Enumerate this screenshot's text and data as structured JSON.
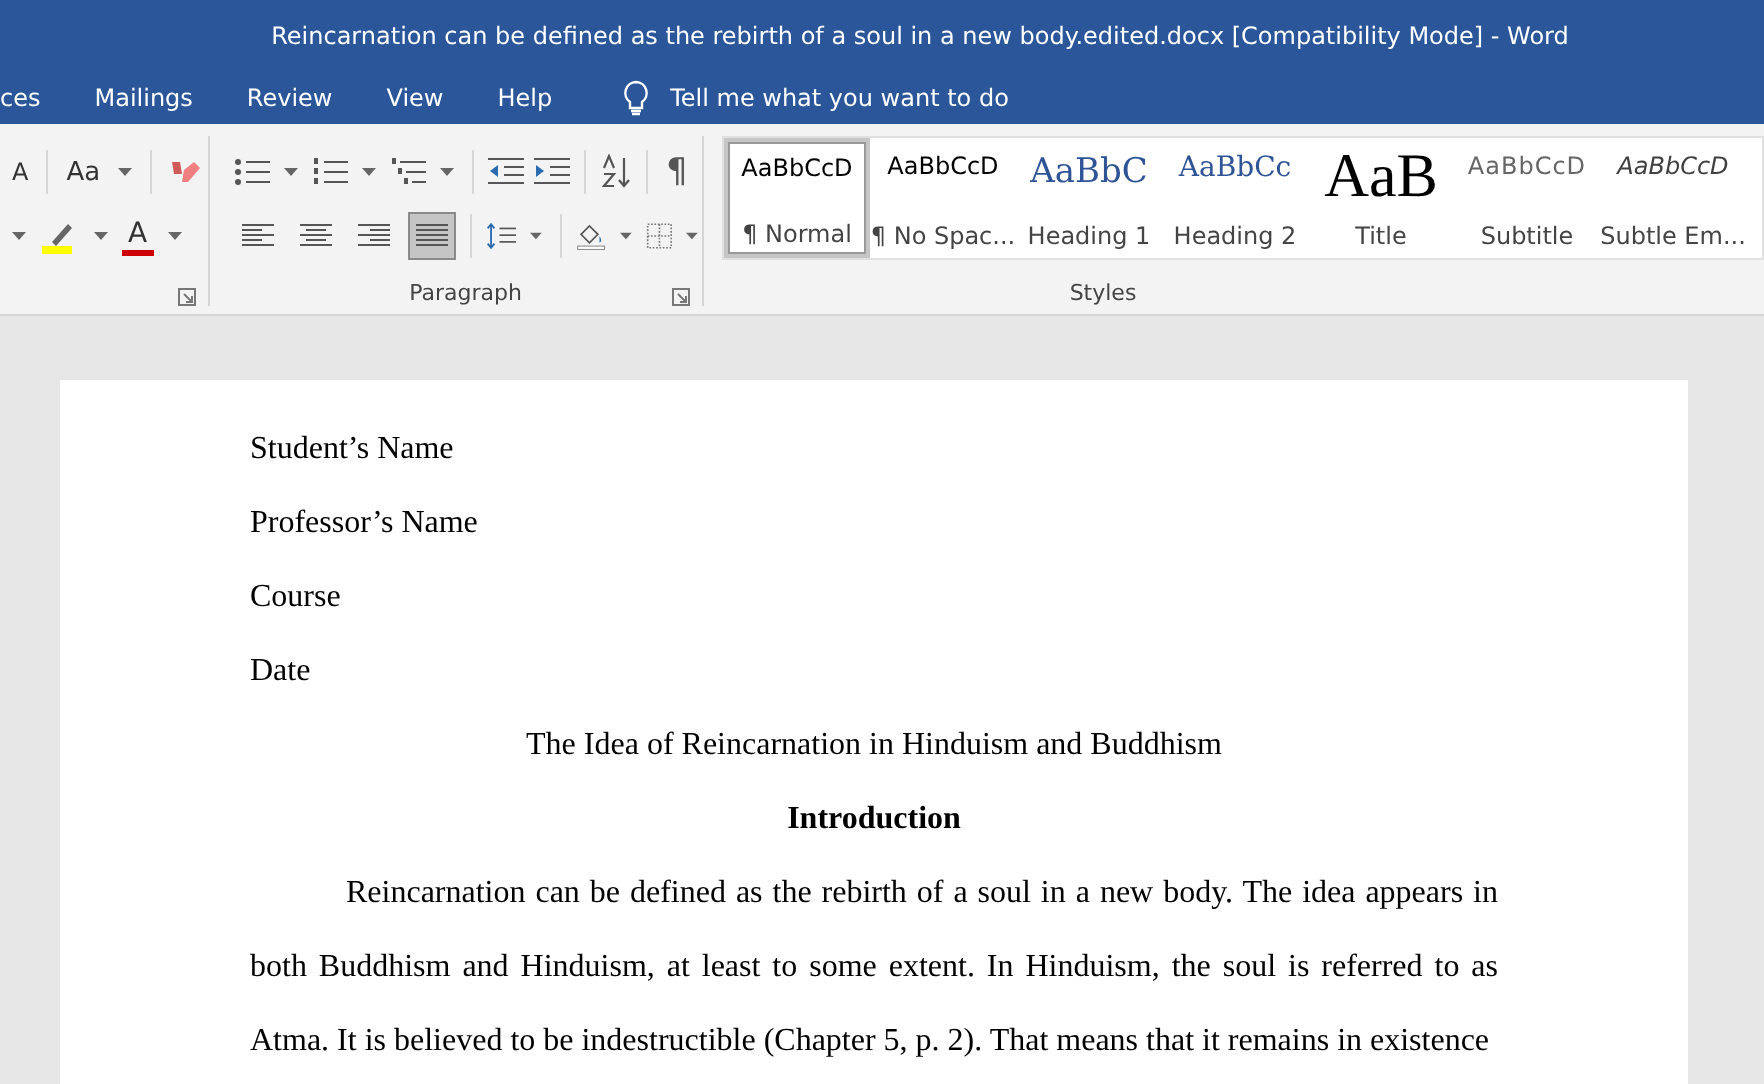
{
  "window": {
    "title": "Reincarnation can be defined as the rebirth of a soul in a new body.edited.docx [Compatibility Mode]  -  Word"
  },
  "tabs": [
    {
      "label": "ces",
      "selected": false
    },
    {
      "label": "Mailings",
      "selected": false
    },
    {
      "label": "Review",
      "selected": false
    },
    {
      "label": "View",
      "selected": false
    },
    {
      "label": "Help",
      "selected": false
    }
  ],
  "tell_me": {
    "placeholder": "Tell me what you want to do"
  },
  "font_group": {
    "grow_font": "A",
    "change_case": "Aa",
    "font_color": "A"
  },
  "paragraph_group": {
    "label": "Paragraph",
    "pilcrow": "¶",
    "alignments": [
      {
        "kind": "left",
        "selected": false
      },
      {
        "kind": "center",
        "selected": false
      },
      {
        "kind": "right",
        "selected": false
      },
      {
        "kind": "justify",
        "selected": true
      }
    ]
  },
  "styles": {
    "label": "Styles",
    "items": [
      {
        "kind": "normal",
        "sample": "AaBbCcD",
        "name": "¶ Normal",
        "selected": true
      },
      {
        "kind": "nospacing",
        "sample": "AaBbCcD",
        "name": "¶ No Spac...",
        "selected": false
      },
      {
        "kind": "heading1",
        "sample": "AaBbC",
        "name": "Heading 1",
        "selected": false
      },
      {
        "kind": "heading2",
        "sample": "AaBbCc",
        "name": "Heading 2",
        "selected": false
      },
      {
        "kind": "title",
        "sample": "AaB",
        "name": "Title",
        "selected": false
      },
      {
        "kind": "subtitle",
        "sample": "AaBbCcD",
        "name": "Subtitle",
        "selected": false
      },
      {
        "kind": "subtle",
        "sample": "AaBbCcD",
        "name": "Subtle Em...",
        "selected": false
      }
    ]
  },
  "document": {
    "blocks": [
      {
        "kind": "line",
        "text": "Student’s Name"
      },
      {
        "kind": "line",
        "text": "Professor’s Name"
      },
      {
        "kind": "line",
        "text": "Course"
      },
      {
        "kind": "line",
        "text": "Date"
      },
      {
        "kind": "title",
        "text": "The Idea of Reincarnation in Hinduism and Buddhism"
      },
      {
        "kind": "heading",
        "text": "Introduction"
      },
      {
        "kind": "paragraph",
        "text": "Reincarnation can be defined as the rebirth of a soul in a new body. The idea appears in both Buddhism and Hinduism, at least to some extent. In Hinduism, the soul is referred to as Atma. It is believed to be indestructible (Chapter 5, p. 2). That means that it remains in existence"
      }
    ]
  }
}
